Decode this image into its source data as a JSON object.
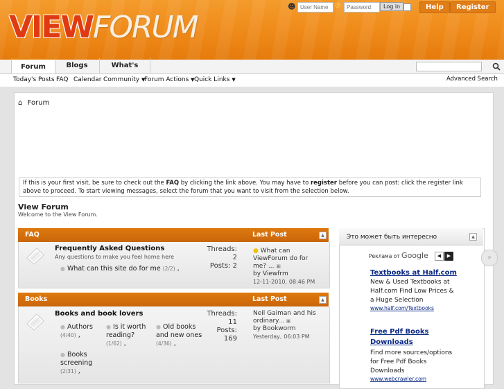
{
  "header": {
    "logo_part1": "VIEW",
    "logo_part2": "FORUM",
    "username_placeholder": "User Name",
    "password_placeholder": "Password",
    "login_label": "Log in",
    "help_label": "Help",
    "register_label": "Register"
  },
  "tabs": [
    "Forum",
    "Blogs",
    "What's New?"
  ],
  "subnav": {
    "items": [
      "Today's Posts",
      "FAQ",
      "Calendar",
      "Community",
      "Forum Actions",
      "Quick Links"
    ],
    "advanced_search": "Advanced Search"
  },
  "breadcrumb": "Forum",
  "notice": {
    "part1": "If this is your first visit, be sure to check out the ",
    "faq": "FAQ",
    "part2": " by clicking the link above. You may have to ",
    "register": "register",
    "part3": " before you can post: click the register link above to proceed. To start viewing messages, select the forum that you want to visit from the selection below."
  },
  "forum_title": "View Forum",
  "forum_subtitle": "Welcome to the View Forum.",
  "categories": [
    {
      "name": "FAQ",
      "last_post_header": "Last Post",
      "forum": {
        "title": "Frequently Asked Questions",
        "desc": "Any questions to make you feel home here",
        "threads_label": "Threads:",
        "threads": "2",
        "posts_label": "Posts:",
        "posts": "2",
        "subforums": [
          {
            "name": "What can this site do for me",
            "count": "(2/2)",
            "sep": ","
          }
        ],
        "last_post": {
          "title": "What can ViewForum do for me? ...",
          "by": "by Viewfrm",
          "date": "12-11-2010,",
          "time": "08:46 PM"
        }
      }
    },
    {
      "name": "Books",
      "last_post_header": "Last Post",
      "forum": {
        "title": "Books and book lovers",
        "threads_label": "Threads:",
        "threads": "11",
        "posts_label": "Posts:",
        "posts": "169",
        "subforums": [
          {
            "name": "Authors",
            "count": "(4/40)",
            "sep": ","
          },
          {
            "name": "Is it worth reading?",
            "count": "(1/62)",
            "sep": ","
          },
          {
            "name": "Old books and new ones",
            "count": "(4/36)",
            "sep": ","
          },
          {
            "name": "Books screening",
            "count": "(2/31)",
            "sep": ","
          }
        ],
        "last_post": {
          "title": "Neil Gaiman and his ordinary...",
          "by": "by Bookworm",
          "date": "Yesterday,",
          "time": "06:03 PM"
        }
      }
    }
  ],
  "ad": {
    "header": "Это может быть интересно",
    "ads_by": "Реклама от",
    "google": "Google",
    "items": [
      {
        "title": "Textbooks at Half.com",
        "text": "New & Used Textbooks at Half.com Find Low Prices & a Huge Selection",
        "url": "www.half.com/Textbooks"
      },
      {
        "title": "Free Pdf Books Downloads",
        "text": "Find more sources/options for Free Pdf Books Downloads",
        "url": "www.webcrawler.com"
      }
    ]
  },
  "colors": {
    "accent": "#e8850f",
    "header_orange": "#f08d1c",
    "link_blue": "#0b2a86"
  }
}
